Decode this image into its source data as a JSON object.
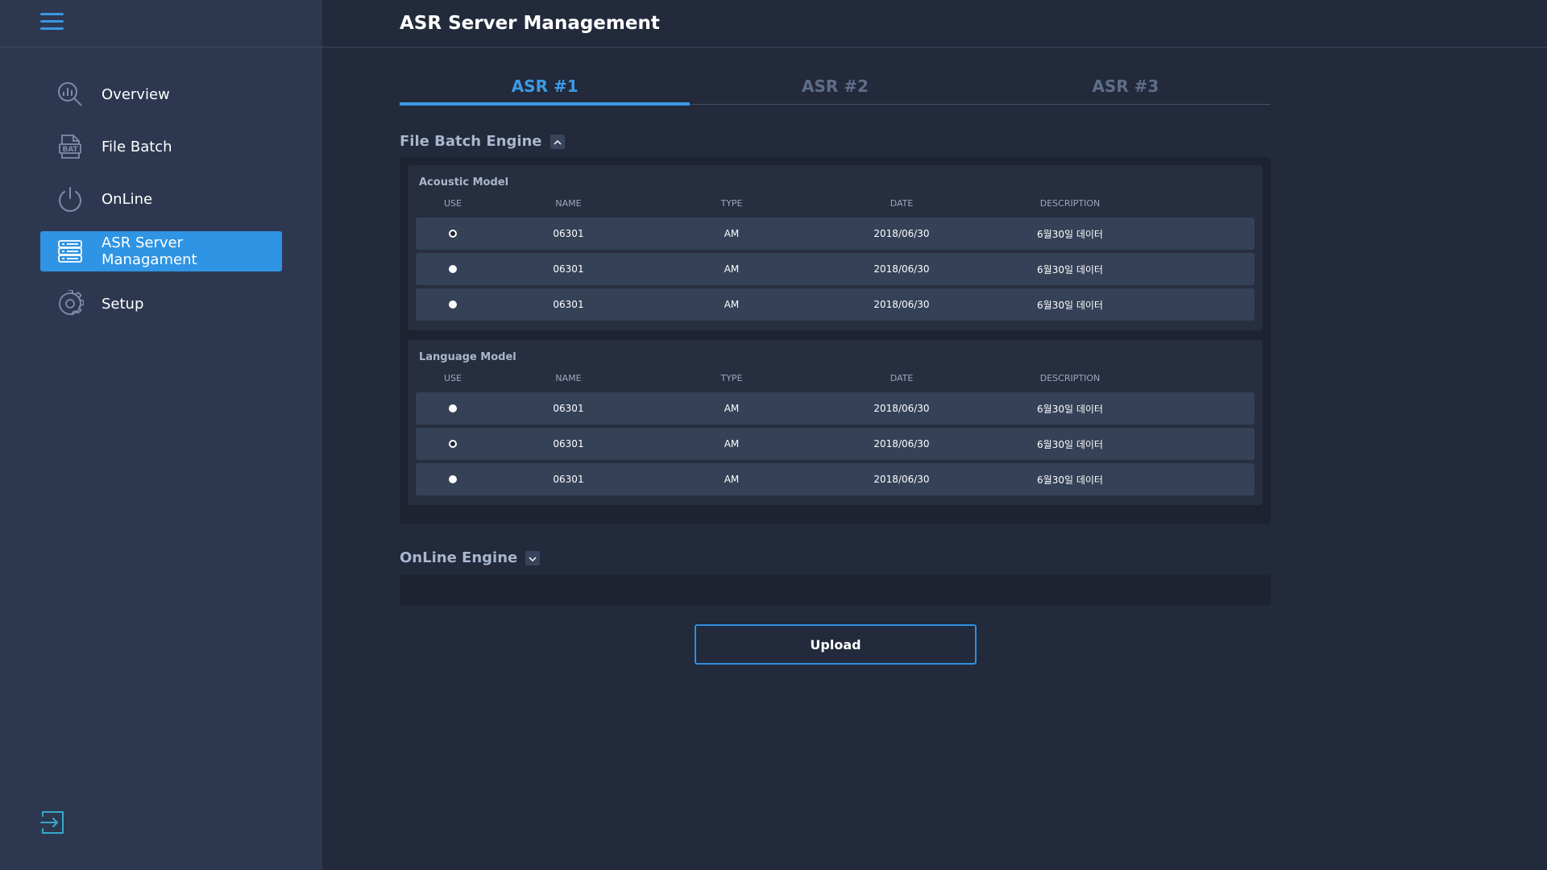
{
  "app": {
    "title": "ASR Server Management"
  },
  "sidebar": {
    "items": [
      {
        "label": "Overview",
        "icon": "overview-search-chart-icon",
        "active": false
      },
      {
        "label": "File Batch",
        "icon": "file-bat-icon",
        "active": false
      },
      {
        "label": "OnLine",
        "icon": "power-icon",
        "active": false
      },
      {
        "label": "ASR Server Managament",
        "icon": "server-list-icon",
        "active": true
      },
      {
        "label": "Setup",
        "icon": "gear-icon",
        "active": false
      }
    ],
    "logout_icon": "logout-icon"
  },
  "tabs": [
    {
      "label": "ASR #1",
      "active": true
    },
    {
      "label": "ASR #2",
      "active": false
    },
    {
      "label": "ASR #3",
      "active": false
    }
  ],
  "file_batch": {
    "title": "File Batch Engine",
    "expanded": true,
    "acoustic": {
      "title": "Acoustic Model",
      "columns": [
        "USE",
        "NAME",
        "TYPE",
        "DATE",
        "DESCRIPTION"
      ],
      "rows": [
        {
          "use": false,
          "name": "06301",
          "type": "AM",
          "date": "2018/06/30",
          "description": "6월30일 데이터"
        },
        {
          "use": true,
          "name": "06301",
          "type": "AM",
          "date": "2018/06/30",
          "description": "6월30일 데이터"
        },
        {
          "use": true,
          "name": "06301",
          "type": "AM",
          "date": "2018/06/30",
          "description": "6월30일 데이터"
        }
      ]
    },
    "language": {
      "title": "Language Model",
      "columns": [
        "USE",
        "NAME",
        "TYPE",
        "DATE",
        "DESCRIPTION"
      ],
      "rows": [
        {
          "use": true,
          "name": "06301",
          "type": "AM",
          "date": "2018/06/30",
          "description": "6월30일 데이터"
        },
        {
          "use": false,
          "name": "06301",
          "type": "AM",
          "date": "2018/06/30",
          "description": "6월30일 데이터"
        },
        {
          "use": true,
          "name": "06301",
          "type": "AM",
          "date": "2018/06/30",
          "description": "6월30일 데이터"
        }
      ]
    }
  },
  "online_engine": {
    "title": "OnLine Engine",
    "expanded": false
  },
  "actions": {
    "upload_label": "Upload"
  },
  "colors": {
    "accent": "#2f94e3",
    "background": "#222a3b",
    "sidebar": "#2d3850",
    "panel": "#1d2331",
    "row": "#344157"
  }
}
